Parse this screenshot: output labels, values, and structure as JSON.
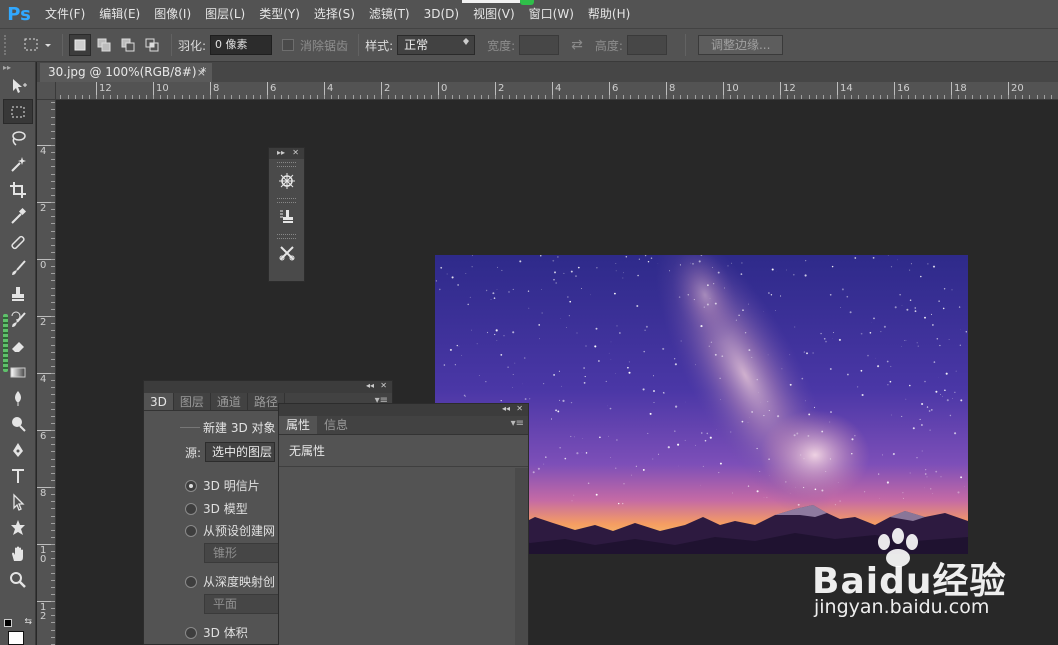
{
  "app": {
    "logo": "Ps"
  },
  "menu": [
    "文件(F)",
    "编辑(E)",
    "图像(I)",
    "图层(L)",
    "类型(Y)",
    "选择(S)",
    "滤镜(T)",
    "3D(D)",
    "视图(V)",
    "窗口(W)",
    "帮助(H)"
  ],
  "options": {
    "feather_label": "羽化:",
    "feather_value": "0 像素",
    "antialias_label": "消除锯齿",
    "style_label": "样式:",
    "style_value": "正常",
    "width_label": "宽度:",
    "height_label": "高度:",
    "refine_edge_label": "调整边缘..."
  },
  "document": {
    "tab_title": "30.jpg @ 100%(RGB/8#) *",
    "close": "×"
  },
  "ruler_h": [
    "12",
    "10",
    "8",
    "6",
    "4",
    "2",
    "0",
    "2",
    "4",
    "6",
    "8",
    "10",
    "12",
    "14",
    "16",
    "18",
    "20"
  ],
  "ruler_v": [
    "4",
    "2",
    "0",
    "2",
    "4",
    "6",
    "8",
    "1\n0",
    "1\n2"
  ],
  "panel_3d": {
    "tabs": [
      "3D",
      "图层",
      "通道",
      "路径"
    ],
    "active_tab": "3D",
    "group_title": "新建 3D 对象",
    "source_label": "源:",
    "source_value": "选中的图层",
    "options": [
      {
        "label": "3D 明信片",
        "selected": true
      },
      {
        "label": "3D 模型",
        "selected": false
      },
      {
        "label": "从预设创建网",
        "selected": false
      },
      {
        "label": "从深度映射创",
        "selected": false
      },
      {
        "label": "3D 体积",
        "selected": false
      }
    ],
    "preset_select": "锥形",
    "depth_select": "平面"
  },
  "panel_props": {
    "tabs": [
      "属性",
      "信息"
    ],
    "active_tab": "属性",
    "content": "无属性"
  },
  "watermark": {
    "logo_text": "Baidu经验",
    "url": "jingyan.baidu.com"
  },
  "colors": {
    "ps_blue": "#31a8ff",
    "ui_dark": "#535353",
    "canvas_bg": "#282828"
  }
}
